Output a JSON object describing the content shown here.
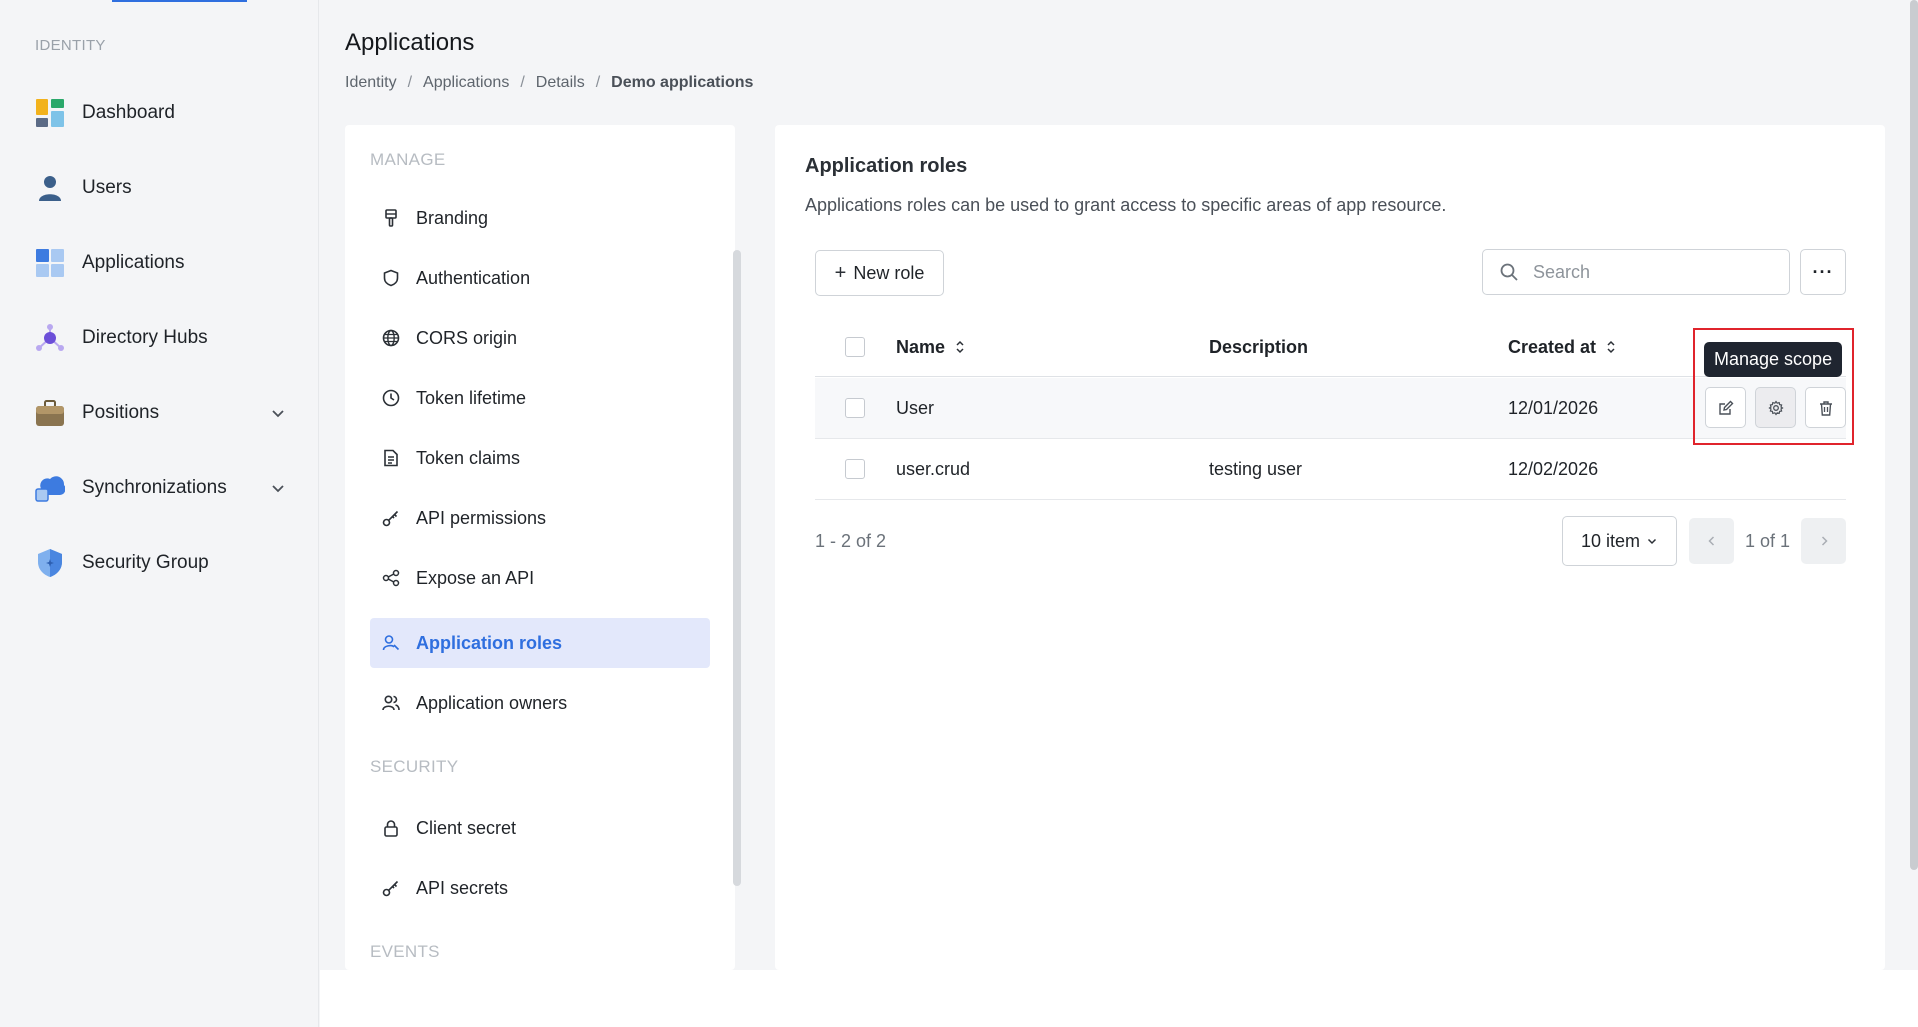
{
  "sidebar": {
    "section_label": "IDENTITY",
    "items": [
      {
        "label": "Dashboard",
        "icon": "dashboard-icon"
      },
      {
        "label": "Users",
        "icon": "user-icon"
      },
      {
        "label": "Applications",
        "icon": "applications-icon"
      },
      {
        "label": "Directory Hubs",
        "icon": "directory-hub-icon"
      },
      {
        "label": "Positions",
        "icon": "briefcase-icon",
        "expandable": true
      },
      {
        "label": "Synchronizations",
        "icon": "cloud-sync-icon",
        "expandable": true
      },
      {
        "label": "Security Group",
        "icon": "shield-icon"
      }
    ]
  },
  "header": {
    "title": "Applications",
    "breadcrumb": [
      "Identity",
      "Applications",
      "Details",
      "Demo applications"
    ],
    "breadcrumb_separator": "/"
  },
  "settings_nav": {
    "manage_label": "MANAGE",
    "manage_items": [
      {
        "label": "Branding",
        "icon": "brush-icon"
      },
      {
        "label": "Authentication",
        "icon": "shield-outline-icon"
      },
      {
        "label": "CORS origin",
        "icon": "globe-icon"
      },
      {
        "label": "Token lifetime",
        "icon": "clock-icon"
      },
      {
        "label": "Token claims",
        "icon": "document-icon"
      },
      {
        "label": "API permissions",
        "icon": "key-icon"
      },
      {
        "label": "Expose an API",
        "icon": "share-icon"
      },
      {
        "label": "Application roles",
        "icon": "user-role-icon",
        "active": true
      },
      {
        "label": "Application owners",
        "icon": "users-icon"
      }
    ],
    "security_label": "SECURITY",
    "security_items": [
      {
        "label": "Client secret",
        "icon": "lock-icon"
      },
      {
        "label": "API secrets",
        "icon": "key-icon"
      }
    ],
    "events_label": "EVENTS"
  },
  "main": {
    "title": "Application roles",
    "description": "Applications roles can be used to grant access to specific areas of app resource.",
    "new_role_label": "New role",
    "search_placeholder": "Search",
    "more_label": "···",
    "columns": {
      "name": "Name",
      "description": "Description",
      "created_at": "Created at"
    },
    "rows": [
      {
        "name": "User",
        "description": "",
        "created_at": "12/01/2026"
      },
      {
        "name": "user.crud",
        "description": "testing user",
        "created_at": "12/02/2026"
      }
    ],
    "tooltip": "Manage scope",
    "range_text": "1 - 2 of 2",
    "page_size": "10 item",
    "page_text": "1 of 1"
  },
  "colors": {
    "accent": "#2f6fdf",
    "active_bg": "#e3e8fb",
    "highlight": "#e0242c",
    "tooltip_bg": "#1f2530"
  }
}
